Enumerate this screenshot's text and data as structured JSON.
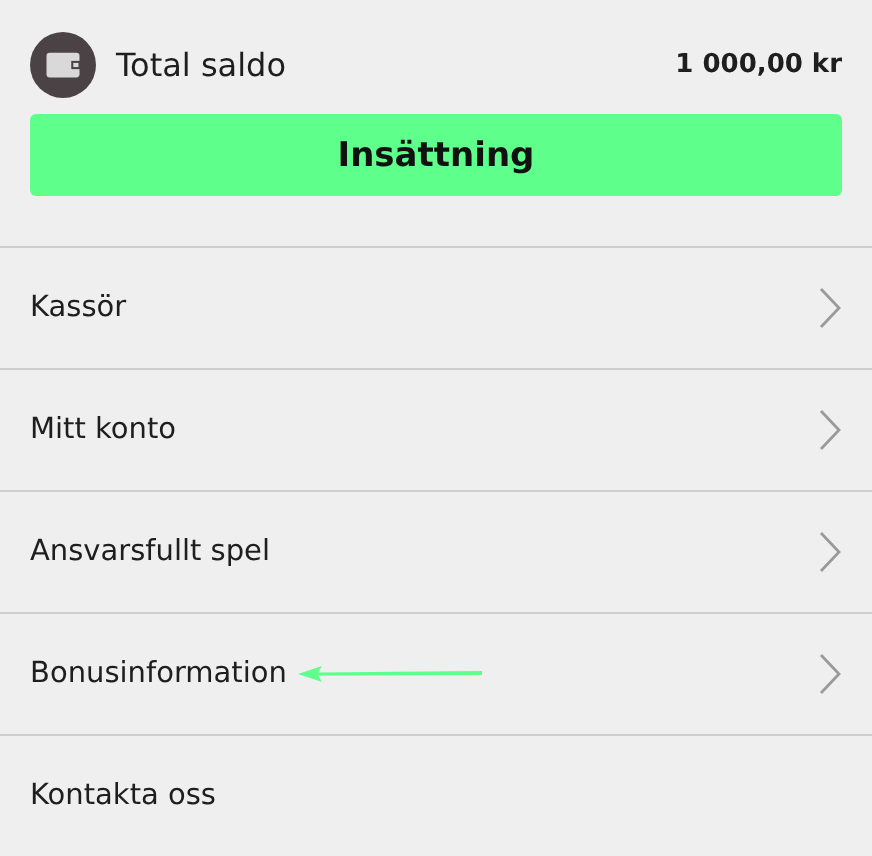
{
  "balance": {
    "label": "Total saldo",
    "amount": "1 000,00 kr"
  },
  "deposit_button": {
    "label": "Insättning"
  },
  "menu": [
    {
      "label": "Kassör",
      "kind": "link",
      "arrow_annotation": false
    },
    {
      "label": "Mitt konto",
      "kind": "link",
      "arrow_annotation": false
    },
    {
      "label": "Ansvarsfullt spel",
      "kind": "link",
      "arrow_annotation": false
    },
    {
      "label": "Bonusinformation",
      "kind": "link",
      "arrow_annotation": true
    },
    {
      "label": "Kontakta oss",
      "kind": "plain",
      "arrow_annotation": false
    }
  ]
}
